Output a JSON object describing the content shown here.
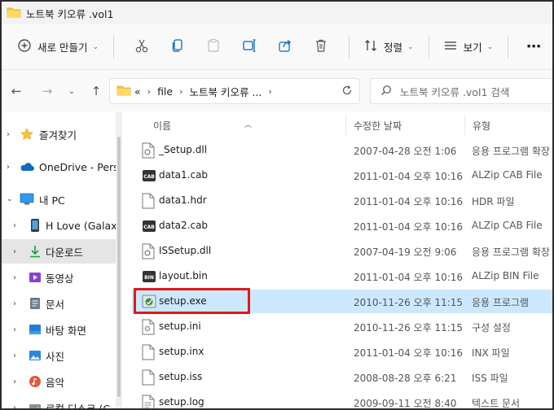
{
  "window": {
    "title": "노트북 키오류 .vol1"
  },
  "toolbar": {
    "new_label": "새로 만들기",
    "cut_icon": "scissors-icon",
    "copy_icon": "copy-icon",
    "paste_icon": "paste-icon",
    "rename_icon": "rename-icon",
    "share_icon": "share-icon",
    "delete_icon": "trash-icon",
    "sort_label": "정렬",
    "view_label": "보기",
    "more_label": "⋯"
  },
  "address": {
    "overflow": "«",
    "crumbs": [
      "file",
      "노트북 키오류 ..."
    ]
  },
  "search": {
    "placeholder": "노트북 키오류 .vol1 검색"
  },
  "sidebar": {
    "items": [
      {
        "label": "즐겨찾기",
        "icon": "star-icon",
        "expanded": false
      },
      {
        "label": "OneDrive - Personal",
        "icon": "cloud-icon",
        "expanded": false
      },
      {
        "label": "내 PC",
        "icon": "monitor-icon",
        "expanded": true
      },
      {
        "label": "H Love (Galaxy",
        "icon": "phone-icon",
        "expanded": false
      },
      {
        "label": "다운로드",
        "icon": "download-icon",
        "expanded": false,
        "selected": true
      },
      {
        "label": "동영상",
        "icon": "video-icon",
        "expanded": false
      },
      {
        "label": "문서",
        "icon": "document-icon",
        "expanded": false
      },
      {
        "label": "바탕 화면",
        "icon": "desktop-icon",
        "expanded": false
      },
      {
        "label": "사진",
        "icon": "picture-icon",
        "expanded": false
      },
      {
        "label": "음악",
        "icon": "music-icon",
        "expanded": false
      },
      {
        "label": "로컬 디스크 (C",
        "icon": "drive-icon",
        "expanded": false
      }
    ]
  },
  "columns": {
    "name": "이름",
    "date": "수정한 날짜",
    "type": "유형"
  },
  "files": [
    {
      "name": "_Setup.dll",
      "date": "2007-04-28 오전 1:06",
      "type": "응용 프로그램 확장",
      "icon": "dll-file-icon"
    },
    {
      "name": "data1.cab",
      "date": "2011-01-04 오후 10:16",
      "type": "ALZip CAB File",
      "icon": "cab-file-icon"
    },
    {
      "name": "data1.hdr",
      "date": "2011-01-04 오후 10:16",
      "type": "HDR 파일",
      "icon": "blank-file-icon"
    },
    {
      "name": "data2.cab",
      "date": "2011-01-04 오후 10:16",
      "type": "ALZip CAB File",
      "icon": "cab-file-icon"
    },
    {
      "name": "ISSetup.dll",
      "date": "2007-04-19 오전 9:06",
      "type": "응용 프로그램 확장",
      "icon": "dll-file-icon"
    },
    {
      "name": "layout.bin",
      "date": "2011-01-04 오후 10:16",
      "type": "ALZip BIN File",
      "icon": "bin-file-icon"
    },
    {
      "name": "setup.exe",
      "date": "2010-11-26 오후 11:15",
      "type": "응용 프로그램",
      "icon": "exe-file-icon",
      "selected": true
    },
    {
      "name": "setup.ini",
      "date": "2010-11-26 오후 11:15",
      "type": "구성 설정",
      "icon": "ini-file-icon"
    },
    {
      "name": "setup.inx",
      "date": "2011-01-04 오후 10:16",
      "type": "INX 파일",
      "icon": "blank-file-icon"
    },
    {
      "name": "setup.iss",
      "date": "2008-08-28 오후 6:21",
      "type": "ISS 파일",
      "icon": "blank-file-icon"
    },
    {
      "name": "setup.log",
      "date": "2009-09-11 오전 8:40",
      "type": "텍스트 문서",
      "icon": "text-file-icon"
    }
  ],
  "colors": {
    "accent": "#0067c0",
    "selection": "#cce8ff",
    "highlight_box": "#e01818",
    "folder": "#f5c84c"
  }
}
